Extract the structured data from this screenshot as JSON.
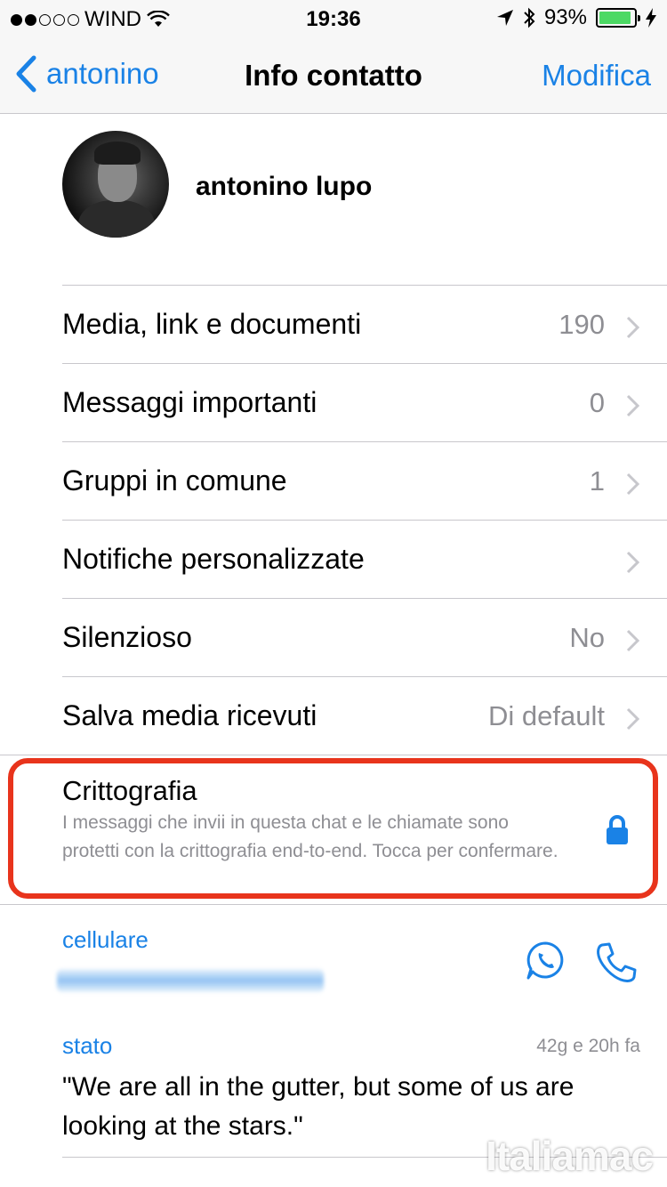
{
  "status_bar": {
    "carrier": "WIND",
    "time": "19:36",
    "battery": "93%",
    "battery_level": 0.93,
    "signal_bars_filled": 2,
    "signal_bars_total": 5
  },
  "nav": {
    "back_label": "antonino",
    "title": "Info contatto",
    "edit_label": "Modifica"
  },
  "profile": {
    "name": "antonino lupo"
  },
  "rows": [
    {
      "label": "Media, link e documenti",
      "value": "190"
    },
    {
      "label": "Messaggi importanti",
      "value": "0"
    },
    {
      "label": "Gruppi in comune",
      "value": "1"
    },
    {
      "label": "Notifiche personalizzate",
      "value": ""
    },
    {
      "label": "Silenzioso",
      "value": "No"
    },
    {
      "label": "Salva media ricevuti",
      "value": "Di default"
    }
  ],
  "encryption": {
    "title": "Crittografia",
    "description": "I messaggi che invii in questa chat e le chiamate sono protetti con la crittografia end-to-end. Tocca per confermare."
  },
  "phone": {
    "label": "cellulare"
  },
  "status": {
    "label": "stato",
    "time_ago": "42g e 20h fa",
    "text": "\"We are all in the gutter, but some of us are looking at the stars.\""
  },
  "watermark": "Italiamac",
  "colors": {
    "accent": "#1a82e6",
    "highlight": "#e8341c",
    "battery": "#4cd964",
    "secondary_text": "#8e8e93"
  }
}
